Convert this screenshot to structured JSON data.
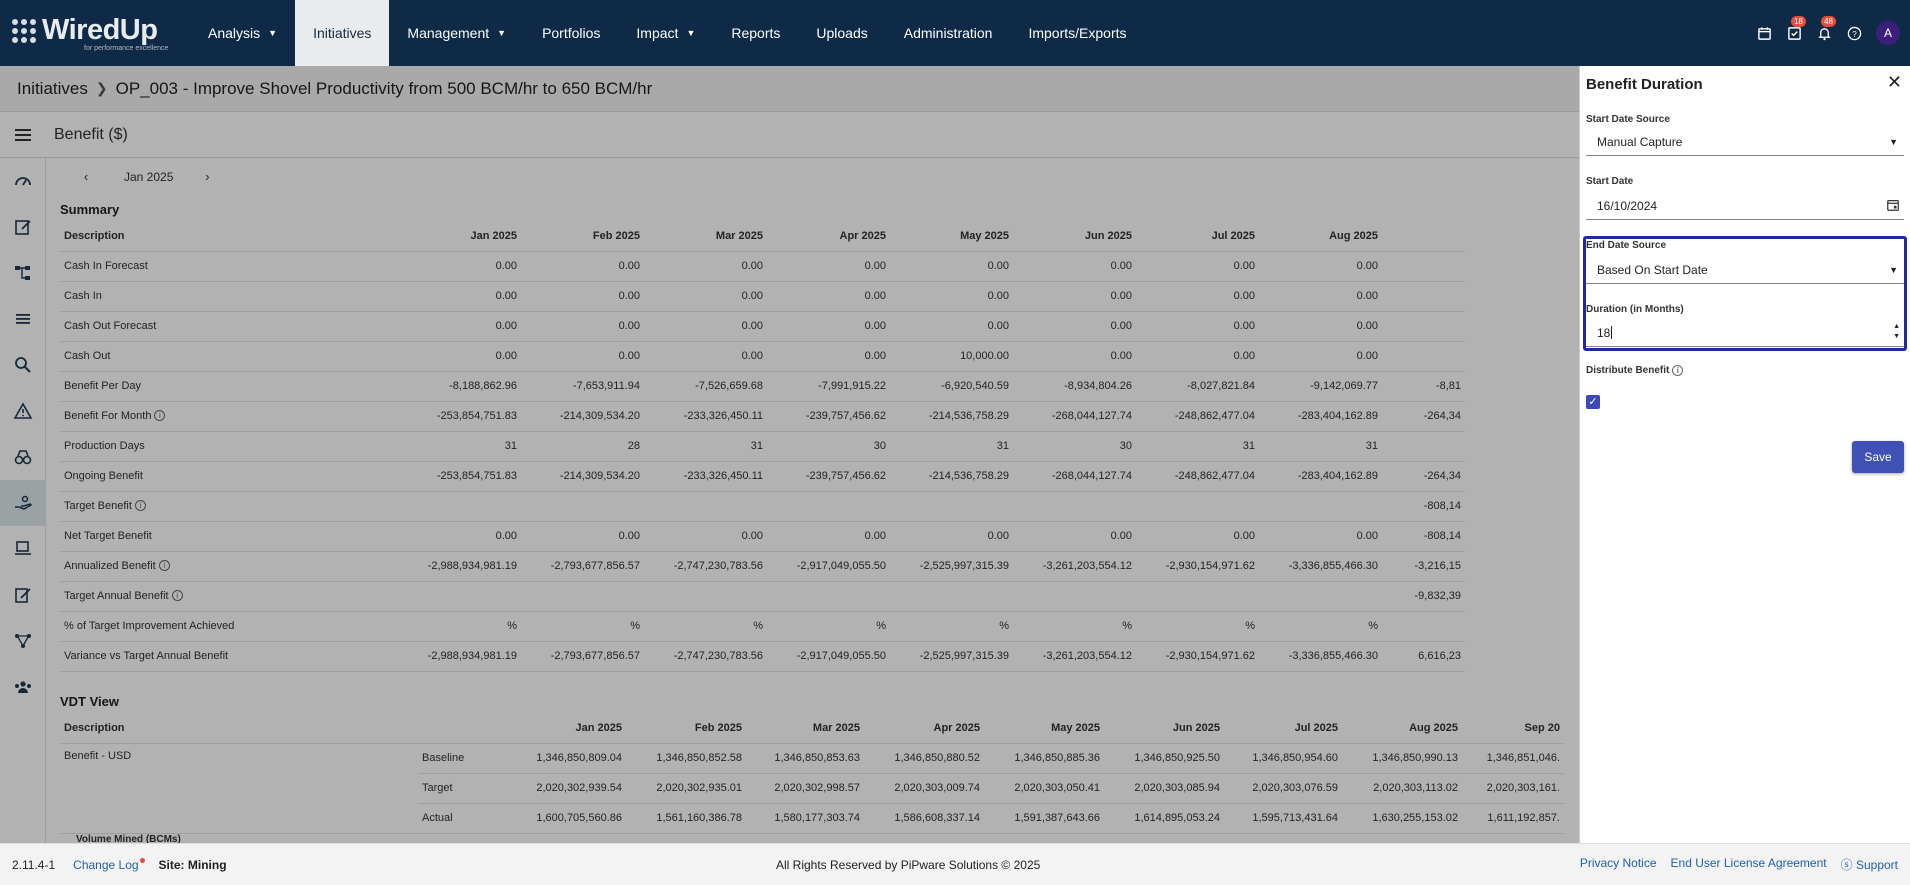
{
  "logo": {
    "name": "WiredUp",
    "tagline": "for performance excellence"
  },
  "nav": [
    {
      "label": "Analysis",
      "dropdown": true
    },
    {
      "label": "Initiatives",
      "active": true
    },
    {
      "label": "Management",
      "dropdown": true
    },
    {
      "label": "Portfolios"
    },
    {
      "label": "Impact",
      "dropdown": true
    },
    {
      "label": "Reports"
    },
    {
      "label": "Uploads"
    },
    {
      "label": "Administration"
    },
    {
      "label": "Imports/Exports"
    }
  ],
  "top_icons": {
    "tasks_badge": "18",
    "notifications_badge": "48",
    "avatar_initial": "A"
  },
  "breadcrumb": {
    "root": "Initiatives",
    "current": "OP_003 - Improve Shovel Productivity from 500 BCM/hr to 650 BCM/hr"
  },
  "section": {
    "title": "Benefit ($)"
  },
  "month_nav": {
    "label": "Jan 2025"
  },
  "summary": {
    "title": "Summary",
    "columns": [
      "Description",
      "Jan 2025",
      "Feb 2025",
      "Mar 2025",
      "Apr 2025",
      "May 2025",
      "Jun 2025",
      "Jul 2025",
      "Aug 2025"
    ],
    "rows": [
      {
        "label": "Cash In Forecast",
        "values": [
          "0.00",
          "0.00",
          "0.00",
          "0.00",
          "0.00",
          "0.00",
          "0.00",
          "0.00"
        ],
        "tail": ""
      },
      {
        "label": "Cash In",
        "values": [
          "0.00",
          "0.00",
          "0.00",
          "0.00",
          "0.00",
          "0.00",
          "0.00",
          "0.00"
        ],
        "tail": ""
      },
      {
        "label": "Cash Out Forecast",
        "values": [
          "0.00",
          "0.00",
          "0.00",
          "0.00",
          "0.00",
          "0.00",
          "0.00",
          "0.00"
        ],
        "tail": ""
      },
      {
        "label": "Cash Out",
        "values": [
          "0.00",
          "0.00",
          "0.00",
          "0.00",
          "10,000.00",
          "0.00",
          "0.00",
          "0.00"
        ],
        "tail": ""
      },
      {
        "label": "Benefit Per Day",
        "values": [
          "-8,188,862.96",
          "-7,653,911.94",
          "-7,526,659.68",
          "-7,991,915.22",
          "-6,920,540.59",
          "-8,934,804.26",
          "-8,027,821.84",
          "-9,142,069.77"
        ],
        "tail": "-8,81"
      },
      {
        "label": "Benefit For Month",
        "info": true,
        "values": [
          "-253,854,751.83",
          "-214,309,534.20",
          "-233,326,450.11",
          "-239,757,456.62",
          "-214,536,758.29",
          "-268,044,127.74",
          "-248,862,477.04",
          "-283,404,162.89"
        ],
        "tail": "-264,34"
      },
      {
        "label": "Production Days",
        "values": [
          "31",
          "28",
          "31",
          "30",
          "31",
          "30",
          "31",
          "31"
        ],
        "tail": ""
      },
      {
        "label": "Ongoing Benefit",
        "values": [
          "-253,854,751.83",
          "-214,309,534.20",
          "-233,326,450.11",
          "-239,757,456.62",
          "-214,536,758.29",
          "-268,044,127.74",
          "-248,862,477.04",
          "-283,404,162.89"
        ],
        "tail": "-264,34"
      },
      {
        "label": "Target Benefit",
        "info": true,
        "values": [
          "",
          "",
          "",
          "",
          "",
          "",
          "",
          ""
        ],
        "tail": "-808,14"
      },
      {
        "label": "Net Target Benefit",
        "values": [
          "0.00",
          "0.00",
          "0.00",
          "0.00",
          "0.00",
          "0.00",
          "0.00",
          "0.00"
        ],
        "tail": "-808,14"
      },
      {
        "label": "Annualized Benefit",
        "info": true,
        "values": [
          "-2,988,934,981.19",
          "-2,793,677,856.57",
          "-2,747,230,783.56",
          "-2,917,049,055.50",
          "-2,525,997,315.39",
          "-3,261,203,554.12",
          "-2,930,154,971.62",
          "-3,336,855,466.30"
        ],
        "tail": "-3,216,15"
      },
      {
        "label": "Target Annual Benefit",
        "info": true,
        "values": [
          "",
          "",
          "",
          "",
          "",
          "",
          "",
          ""
        ],
        "tail": "-9,832,39"
      },
      {
        "label": "% of Target Improvement Achieved",
        "values": [
          "%",
          "%",
          "%",
          "%",
          "%",
          "%",
          "%",
          "%"
        ],
        "tail": ""
      },
      {
        "label": "Variance vs Target Annual Benefit",
        "values": [
          "-2,988,934,981.19",
          "-2,793,677,856.57",
          "-2,747,230,783.56",
          "-2,917,049,055.50",
          "-2,525,997,315.39",
          "-3,261,203,554.12",
          "-2,930,154,971.62",
          "-3,336,855,466.30"
        ],
        "tail": "6,616,23"
      }
    ]
  },
  "vdt": {
    "title": "VDT View",
    "columns": [
      "Description",
      "",
      "Jan 2025",
      "Feb 2025",
      "Mar 2025",
      "Apr 2025",
      "May 2025",
      "Jun 2025",
      "Jul 2025",
      "Aug 2025",
      "Sep 20"
    ],
    "group": "Benefit - USD",
    "rows": [
      {
        "label": "Baseline",
        "values": [
          "1,346,850,809.04",
          "1,346,850,852.58",
          "1,346,850,853.63",
          "1,346,850,880.52",
          "1,346,850,885.36",
          "1,346,850,925.50",
          "1,346,850,954.60",
          "1,346,850,990.13",
          "1,346,851,046."
        ]
      },
      {
        "label": "Target",
        "values": [
          "2,020,302,939.54",
          "2,020,302,935.01",
          "2,020,302,998.57",
          "2,020,303,009.74",
          "2,020,303,050.41",
          "2,020,303,085.94",
          "2,020,303,076.59",
          "2,020,303,113.02",
          "2,020,303,161."
        ]
      },
      {
        "label": "Actual",
        "values": [
          "1,600,705,560.86",
          "1,561,160,386.78",
          "1,580,177,303.74",
          "1,586,608,337.14",
          "1,591,387,643.66",
          "1,614,895,053.24",
          "1,595,713,431.64",
          "1,630,255,153.02",
          "1,611,192,857."
        ]
      }
    ],
    "partial_row": "Volume Mined (BCMs)"
  },
  "panel": {
    "title": "Benefit Duration",
    "start_date_source_label": "Start Date Source",
    "start_date_source": "Manual Capture",
    "start_date_label": "Start Date",
    "start_date": "16/10/2024",
    "end_date_source_label": "End Date Source",
    "end_date_source": "Based On Start Date",
    "duration_label": "Duration (in Months)",
    "duration": "18",
    "distribute_label": "Distribute Benefit",
    "distribute_checked": true,
    "save_label": "Save"
  },
  "footer": {
    "version": "2.11.4-1",
    "changelog": "Change Log",
    "site": "Site: Mining",
    "copyright": "All Rights Reserved by PiPware Solutions © 2025",
    "privacy": "Privacy Notice",
    "eula": "End User License Agreement",
    "support": "Support"
  },
  "colors": {
    "topbar": "#0e2a47",
    "accent": "#3f51b5",
    "highlight": "#1f2a9c",
    "link": "#1f5fae"
  }
}
